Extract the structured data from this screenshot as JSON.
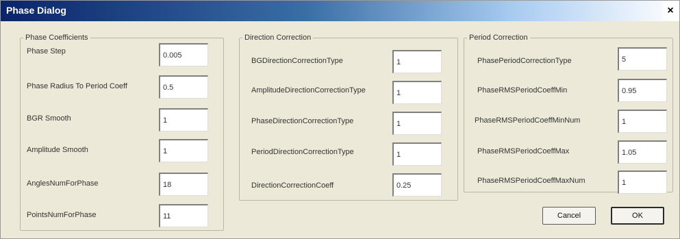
{
  "window": {
    "title": "Phase Dialog",
    "close_glyph": "×"
  },
  "phase_coefficients": {
    "legend": "Phase Coefficients",
    "fields": [
      {
        "label": "Phase Step",
        "value": "0.005"
      },
      {
        "label": "Phase Radius To Period Coeff",
        "value": "0.5"
      },
      {
        "label": "BGR Smooth",
        "value": "1"
      },
      {
        "label": "Amplitude Smooth",
        "value": "1"
      },
      {
        "label": "AnglesNumForPhase",
        "value": "18"
      },
      {
        "label": "PointsNumForPhase",
        "value": "11"
      }
    ]
  },
  "direction_correction": {
    "legend": "Direction Correction",
    "fields": [
      {
        "label": "BGDirectionCorrectionType",
        "value": "1"
      },
      {
        "label": "AmplitudeDirectionCorrectionType",
        "value": "1"
      },
      {
        "label": "PhaseDirectionCorrectionType",
        "value": "1"
      },
      {
        "label": "PeriodDirectionCorrectionType",
        "value": "1"
      },
      {
        "label": "DirectionCorrectionCoeff",
        "value": "0.25"
      }
    ]
  },
  "period_correction": {
    "legend": "Period Correction",
    "fields": [
      {
        "label": "PhasePeriodCorrectionType",
        "value": "5"
      },
      {
        "label": "PhaseRMSPeriodCoeffMin",
        "value": "0.95"
      },
      {
        "label": "PhaseRMSPeriodCoeffMinNum",
        "value": "1"
      },
      {
        "label": "PhaseRMSPeriodCoeffMax",
        "value": "1.05"
      },
      {
        "label": "PhaseRMSPeriodCoeffMaxNum",
        "value": "1"
      }
    ]
  },
  "buttons": {
    "cancel": "Cancel",
    "ok": "OK"
  },
  "colors": {
    "title_bar_start": "#0a246a",
    "title_bar_end": "#a6caf0",
    "dialog_face": "#ece9d8"
  }
}
